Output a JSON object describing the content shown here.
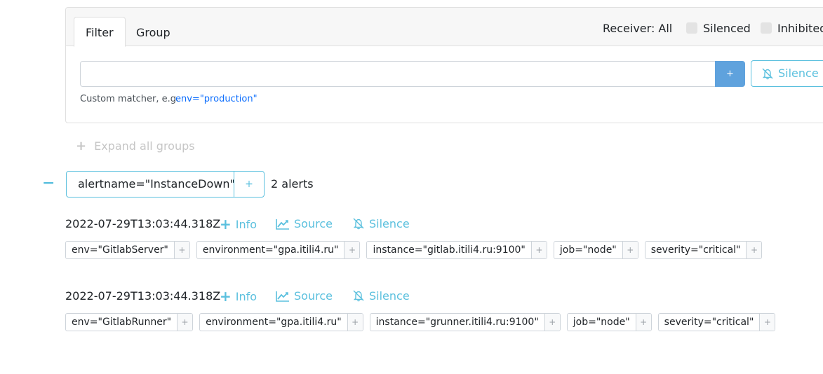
{
  "filter_panel": {
    "tabs": [
      {
        "label": "Filter",
        "active": true
      },
      {
        "label": "Group",
        "active": false
      }
    ],
    "receiver_label": "Receiver: All",
    "silenced_label": "Silenced",
    "silenced_checked": false,
    "inhibited_label": "Inhibited",
    "inhibited_checked": false,
    "input_value": "",
    "input_placeholder": "",
    "add_button_label": "+",
    "silence_button_label": "Silence",
    "hint_label": "Custom matcher, e.g.",
    "hint_example": "env=\"production\""
  },
  "expand_all": {
    "icon": "plus-icon",
    "label": "Expand all groups"
  },
  "group": {
    "collapse_icon": "minus-icon",
    "label": "alertname=\"InstanceDown\"",
    "add_label": "+",
    "count_label": "2 alerts"
  },
  "alerts": [
    {
      "timestamp": "2022-07-29T13:03:44.318Z",
      "actions": {
        "info": "Info",
        "source": "Source",
        "silence": "Silence"
      },
      "labels": [
        "env=\"GitlabServer\"",
        "environment=\"gpa.itili4.ru\"",
        "instance=\"gitlab.itili4.ru:9100\"",
        "job=\"node\"",
        "severity=\"critical\""
      ]
    },
    {
      "timestamp": "2022-07-29T13:03:44.318Z",
      "actions": {
        "info": "Info",
        "source": "Source",
        "silence": "Silence"
      },
      "labels": [
        "env=\"GitlabRunner\"",
        "environment=\"gpa.itili4.ru\"",
        "instance=\"grunner.itili4.ru:9100\"",
        "job=\"node\"",
        "severity=\"critical\""
      ]
    }
  ],
  "label_add_symbol": "+",
  "colors": {
    "accent": "#5bc0de",
    "primary_button": "#5fa2dd",
    "link": "#0d6efd",
    "muted": "#c6c6c6"
  }
}
